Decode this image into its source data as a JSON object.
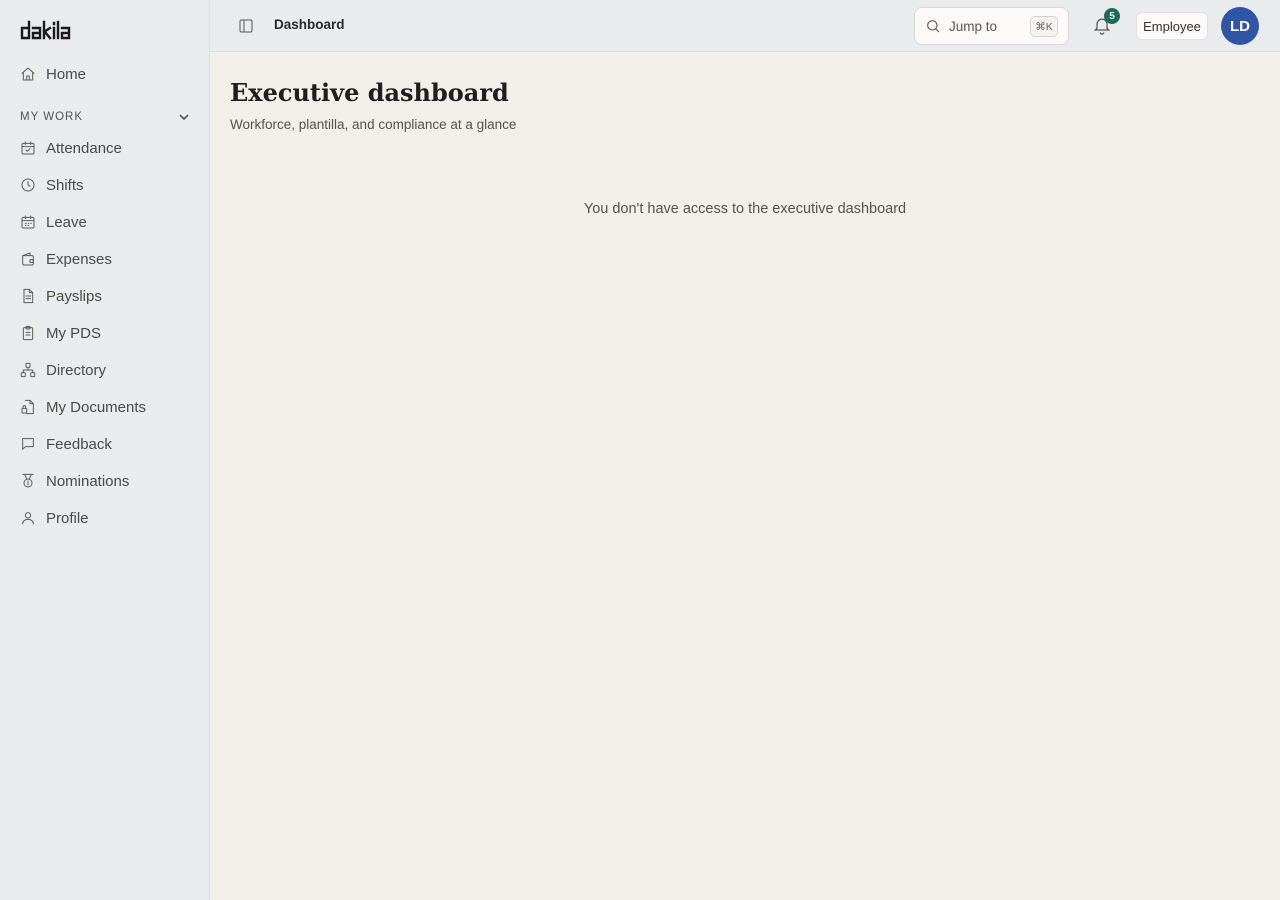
{
  "brand": {
    "logo_text": "dakila"
  },
  "sidebar": {
    "home_label": "Home",
    "section_label": "MY WORK",
    "items": [
      {
        "label": "Attendance",
        "icon": "calendar-check-icon"
      },
      {
        "label": "Shifts",
        "icon": "clock-icon"
      },
      {
        "label": "Leave",
        "icon": "calendar-icon"
      },
      {
        "label": "Expenses",
        "icon": "wallet-icon"
      },
      {
        "label": "Payslips",
        "icon": "file-text-icon"
      },
      {
        "label": "My PDS",
        "icon": "clipboard-icon"
      },
      {
        "label": "Directory",
        "icon": "org-chart-icon"
      },
      {
        "label": "My Documents",
        "icon": "document-lock-icon"
      },
      {
        "label": "Feedback",
        "icon": "message-square-icon"
      },
      {
        "label": "Nominations",
        "icon": "medal-icon"
      },
      {
        "label": "Profile",
        "icon": "user-icon"
      }
    ]
  },
  "topbar": {
    "breadcrumb": "Dashboard",
    "jump_label": "Jump to",
    "jump_shortcut": "⌘K",
    "notification_count": "5",
    "role": "Employee",
    "avatar_initials": "LD",
    "avatar_color": "#2f56a6",
    "badge_color": "#1f6b5a"
  },
  "main": {
    "title": "Executive dashboard",
    "subtitle": "Workforce, plantilla, and compliance at a glance",
    "empty_message": "You don't have access to the executive dashboard"
  }
}
